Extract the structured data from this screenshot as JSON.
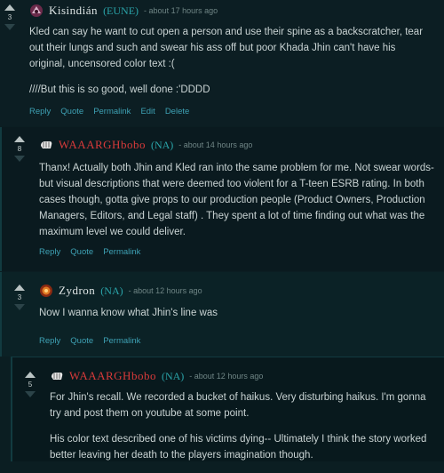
{
  "comments": [
    {
      "votes": "3",
      "author": "Kisindián",
      "region": "(EUNE)",
      "time": "- about 17 hours ago",
      "paragraphs": [
        "Kled can say he want to cut open a person and use their spine as a backscratcher, tear out their lungs and such and swear his ass off but poor Khada Jhin can't have his original, uncensored color text :(",
        "////But this is so good, well done :'DDDD"
      ],
      "actions": [
        "Reply",
        "Quote",
        "Permalink",
        "Edit",
        "Delete"
      ]
    },
    {
      "votes": "8",
      "author": "WAAARGHbobo",
      "region": "(NA)",
      "time": "- about 14 hours ago",
      "paragraphs": [
        "Thanx! Actually both Jhin and Kled ran into the same problem for me. Not swear words- but visual descriptions that were deemed too violent for a T-teen ESRB rating. In both cases though, gotta give props to our production people (Product Owners, Production Managers, Editors, and Legal staff) . They spent a lot of time finding out what was the maximum level we could deliver."
      ],
      "actions": [
        "Reply",
        "Quote",
        "Permalink"
      ]
    },
    {
      "votes": "3",
      "author": "Zydron",
      "region": "(NA)",
      "time": "- about 12 hours ago",
      "paragraphs": [
        "Now I wanna know what Jhin's line was"
      ],
      "actions": [
        "Reply",
        "Quote",
        "Permalink"
      ]
    },
    {
      "votes": "5",
      "author": "WAAARGHbobo",
      "region": "(NA)",
      "time": "- about 12 hours ago",
      "paragraphs": [
        "For Jhin's recall. We recorded a bucket of haikus. Very disturbing haikus. I'm gonna try and post them on youtube at some point.",
        "His color text described one of his victims dying-- Ultimately I think the story worked better leaving her death to the players imagination though."
      ],
      "actions": []
    }
  ],
  "colors": {
    "riot_red": "#d83a3a",
    "region_teal": "#2aa3a8",
    "link_blue": "#3ea1b4"
  }
}
